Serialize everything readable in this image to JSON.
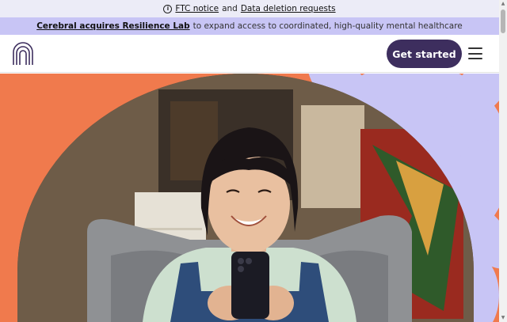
{
  "notice": {
    "icon": "info-icon",
    "ftc_link": "FTC notice",
    "connector": "and",
    "deletion_link": "Data deletion requests"
  },
  "promo": {
    "link": "Cerebral acquires Resilience Lab",
    "text": "to expand access to coordinated, high-quality mental healthcare"
  },
  "header": {
    "logo_icon": "arch-logo-icon",
    "cta_label": "Get started",
    "menu_icon": "hamburger-menu-icon"
  },
  "hero": {
    "image": "smiling woman in overalls using a smartphone",
    "background_color": "#f07a4d",
    "flower_color": "#c8c5f5"
  },
  "colors": {
    "brand_dark": "#3d2e5e",
    "notice_bg": "#ececf7",
    "promo_bg": "#c8c5f5"
  }
}
